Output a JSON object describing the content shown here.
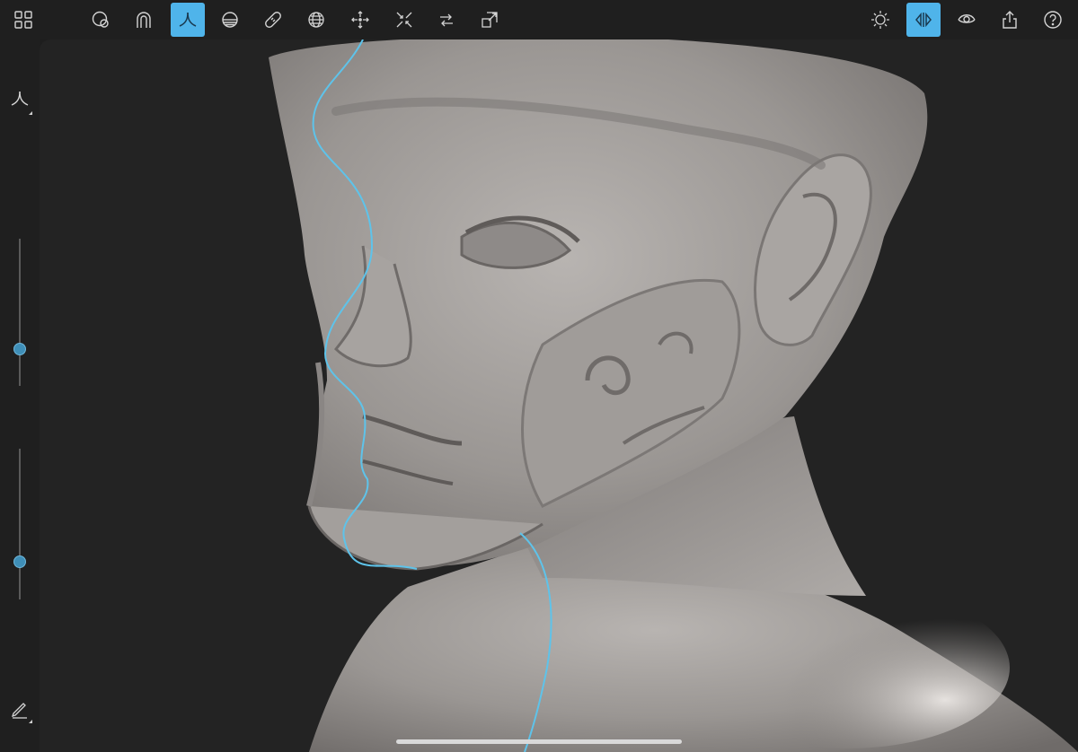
{
  "toolbar": {
    "left_items": [
      {
        "name": "grid-menu-icon"
      },
      {
        "name": "brush-library-icon"
      },
      {
        "name": "magnet-icon"
      },
      {
        "name": "standard-brush-icon"
      },
      {
        "name": "hemisphere-icon"
      },
      {
        "name": "bandage-icon"
      },
      {
        "name": "globe-icon"
      },
      {
        "name": "inflate-icon"
      },
      {
        "name": "pinch-icon"
      },
      {
        "name": "swap-arrows-icon"
      },
      {
        "name": "transform-icon"
      }
    ],
    "active_tool": "standard-brush-icon",
    "right_items": [
      {
        "name": "lighting-icon"
      },
      {
        "name": "symmetry-icon"
      },
      {
        "name": "eye-icon"
      },
      {
        "name": "share-icon"
      },
      {
        "name": "help-icon"
      }
    ],
    "symmetry_active": true
  },
  "left_rail": {
    "top_tool": "standard-brush-icon",
    "bottom_tool": "pencil-icon",
    "size_slider_value": 0.25,
    "strength_slider_value": 0.25
  },
  "colors": {
    "accent": "#4fb4ea",
    "symmetry_line": "#5ec3ea",
    "toolbar_bg": "#1f1f1f",
    "viewport_bg": "#232323",
    "clay": "#9c9896"
  }
}
